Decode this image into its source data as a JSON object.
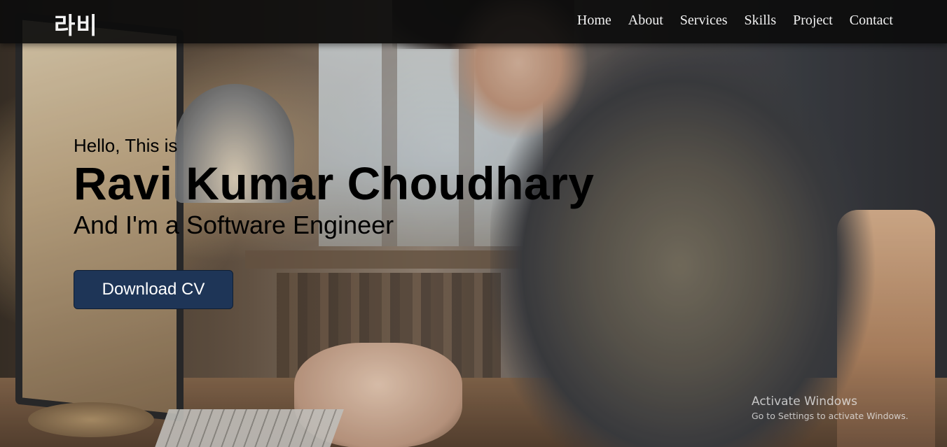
{
  "navbar": {
    "logo": "라비",
    "links": [
      "Home",
      "About",
      "Services",
      "Skills",
      "Project",
      "Contact"
    ]
  },
  "hero": {
    "greeting": "Hello, This is",
    "name": "Ravi Kumar Choudhary",
    "tagline": "And I'm a Software Engineer",
    "cta_label": "Download CV",
    "cta_color": "#1e3557"
  },
  "watermark": {
    "title": "Activate Windows",
    "subtitle": "Go to Settings to activate Windows."
  }
}
